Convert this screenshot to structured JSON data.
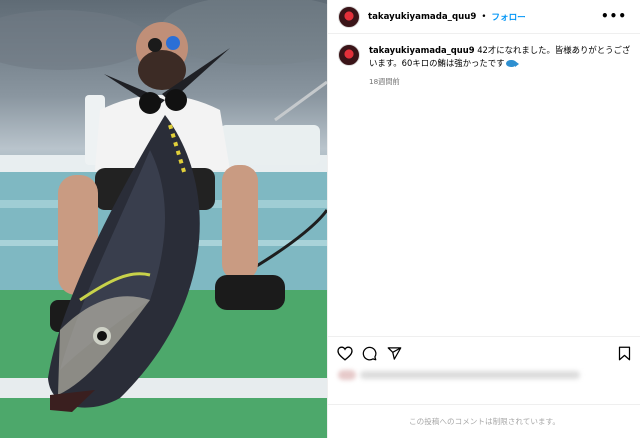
{
  "post": {
    "image_alt": "",
    "username": "takayukiyamada_quu9",
    "separator": "•",
    "follow_label": "フォロー",
    "more_label": "•••"
  },
  "caption": {
    "username": "takayukiyamada_quu9",
    "text": " 42才になれました。皆様ありがとうございます。60キロの鮪は強かったです",
    "emoji": "fish-icon",
    "time": "18週間前"
  },
  "actions": {
    "like": "heart-icon",
    "comment": "comment-icon",
    "share": "share-icon",
    "save": "bookmark-icon"
  },
  "footer": {
    "notice": "この投稿へのコメントは制限されています。"
  },
  "colors": {
    "follow": "#0095f6",
    "muted": "#737373",
    "footer_text": "#a8a8a8"
  }
}
